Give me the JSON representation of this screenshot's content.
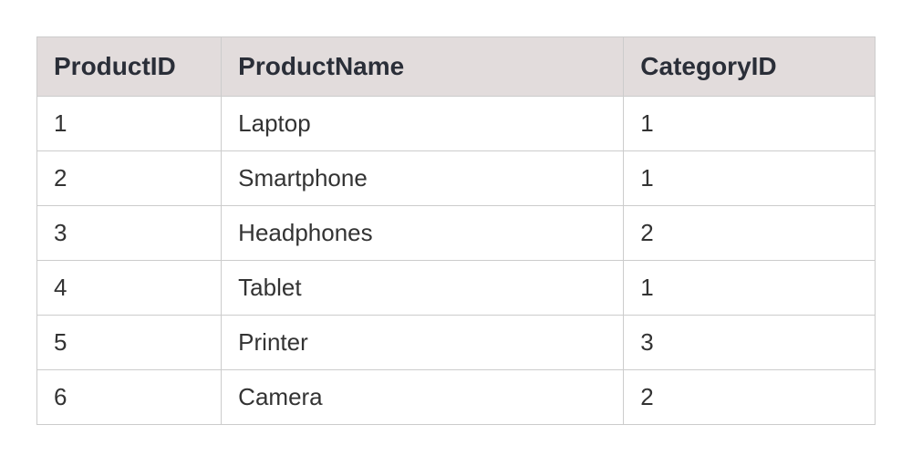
{
  "chart_data": {
    "type": "table",
    "columns": [
      "ProductID",
      "ProductName",
      "CategoryID"
    ],
    "rows": [
      {
        "ProductID": "1",
        "ProductName": "Laptop",
        "CategoryID": "1"
      },
      {
        "ProductID": "2",
        "ProductName": "Smartphone",
        "CategoryID": "1"
      },
      {
        "ProductID": "3",
        "ProductName": "Headphones",
        "CategoryID": "2"
      },
      {
        "ProductID": "4",
        "ProductName": "Tablet",
        "CategoryID": "1"
      },
      {
        "ProductID": "5",
        "ProductName": "Printer",
        "CategoryID": "3"
      },
      {
        "ProductID": "6",
        "ProductName": "Camera",
        "CategoryID": "2"
      }
    ]
  }
}
